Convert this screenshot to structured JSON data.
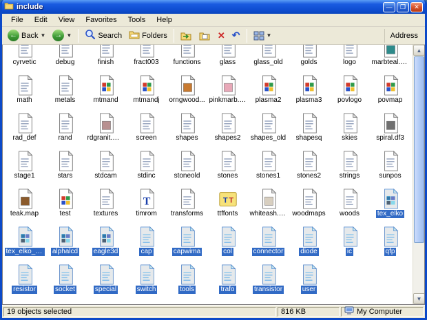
{
  "window": {
    "title": "include"
  },
  "menu": {
    "items": [
      "File",
      "Edit",
      "View",
      "Favorites",
      "Tools",
      "Help"
    ]
  },
  "toolbar": {
    "back_label": "Back",
    "search_label": "Search",
    "folders_label": "Folders",
    "address_label": "Address"
  },
  "status": {
    "selection": "19 objects selected",
    "size": "816 KB",
    "zone": "My Computer"
  },
  "files": [
    {
      "name": "cyrvetic",
      "type": "doc"
    },
    {
      "name": "debug",
      "type": "doc"
    },
    {
      "name": "finish",
      "type": "doc"
    },
    {
      "name": "fract003",
      "type": "doc"
    },
    {
      "name": "functions",
      "type": "doc"
    },
    {
      "name": "glass",
      "type": "doc"
    },
    {
      "name": "glass_old",
      "type": "doc"
    },
    {
      "name": "golds",
      "type": "doc"
    },
    {
      "name": "logo",
      "type": "doc"
    },
    {
      "name": "marbteal.map",
      "type": "map",
      "tint": "#2e8b8b"
    },
    {
      "name": "math",
      "type": "doc"
    },
    {
      "name": "metals",
      "type": "doc"
    },
    {
      "name": "mtmand",
      "type": "image"
    },
    {
      "name": "mtmandj",
      "type": "image"
    },
    {
      "name": "orngwood...",
      "type": "map",
      "tint": "#c87a30"
    },
    {
      "name": "pinkmarb.map",
      "type": "map",
      "tint": "#e8a8b8"
    },
    {
      "name": "plasma2",
      "type": "image"
    },
    {
      "name": "plasma3",
      "type": "image"
    },
    {
      "name": "povlogo",
      "type": "image"
    },
    {
      "name": "povmap",
      "type": "image"
    },
    {
      "name": "rad_def",
      "type": "doc"
    },
    {
      "name": "rand",
      "type": "doc"
    },
    {
      "name": "rdgranit.map",
      "type": "map",
      "tint": "#b89090"
    },
    {
      "name": "screen",
      "type": "doc"
    },
    {
      "name": "shapes",
      "type": "doc"
    },
    {
      "name": "shapes2",
      "type": "doc"
    },
    {
      "name": "shapes_old",
      "type": "doc"
    },
    {
      "name": "shapesq",
      "type": "doc"
    },
    {
      "name": "skies",
      "type": "doc"
    },
    {
      "name": "spiral.df3",
      "type": "map",
      "tint": "#707070"
    },
    {
      "name": "stage1",
      "type": "doc"
    },
    {
      "name": "stars",
      "type": "doc"
    },
    {
      "name": "stdcam",
      "type": "doc"
    },
    {
      "name": "stdinc",
      "type": "doc"
    },
    {
      "name": "stoneold",
      "type": "doc"
    },
    {
      "name": "stones",
      "type": "doc"
    },
    {
      "name": "stones1",
      "type": "doc"
    },
    {
      "name": "stones2",
      "type": "doc"
    },
    {
      "name": "strings",
      "type": "doc"
    },
    {
      "name": "sunpos",
      "type": "doc"
    },
    {
      "name": "teak.map",
      "type": "map",
      "tint": "#8b5a2b"
    },
    {
      "name": "test",
      "type": "image"
    },
    {
      "name": "textures",
      "type": "doc"
    },
    {
      "name": "timrom",
      "type": "font"
    },
    {
      "name": "transforms",
      "type": "doc"
    },
    {
      "name": "ttffonts",
      "type": "fonts"
    },
    {
      "name": "whiteash.map",
      "type": "map",
      "tint": "#d8cfc0"
    },
    {
      "name": "woodmaps",
      "type": "doc"
    },
    {
      "name": "woods",
      "type": "doc"
    },
    {
      "name": "tex_elko",
      "type": "image",
      "selected": true
    },
    {
      "name": "tex_elko_axial",
      "type": "image",
      "selected": true
    },
    {
      "name": "alphalcd",
      "type": "image",
      "selected": true
    },
    {
      "name": "eagle3d",
      "type": "image",
      "selected": true
    },
    {
      "name": "cap",
      "type": "doc",
      "selected": true
    },
    {
      "name": "capwima",
      "type": "doc",
      "selected": true
    },
    {
      "name": "col",
      "type": "doc",
      "selected": true
    },
    {
      "name": "connector",
      "type": "doc",
      "selected": true
    },
    {
      "name": "diode",
      "type": "doc",
      "selected": true
    },
    {
      "name": "ic",
      "type": "doc",
      "selected": true
    },
    {
      "name": "qfp",
      "type": "doc",
      "selected": true
    },
    {
      "name": "resistor",
      "type": "doc",
      "selected": true
    },
    {
      "name": "socket",
      "type": "doc",
      "selected": true
    },
    {
      "name": "special",
      "type": "doc",
      "selected": true
    },
    {
      "name": "switch",
      "type": "doc",
      "selected": true
    },
    {
      "name": "tools",
      "type": "doc",
      "selected": true
    },
    {
      "name": "trafo",
      "type": "doc",
      "selected": true
    },
    {
      "name": "transistor",
      "type": "doc",
      "selected": true
    },
    {
      "name": "user",
      "type": "doc",
      "selected": true
    }
  ]
}
